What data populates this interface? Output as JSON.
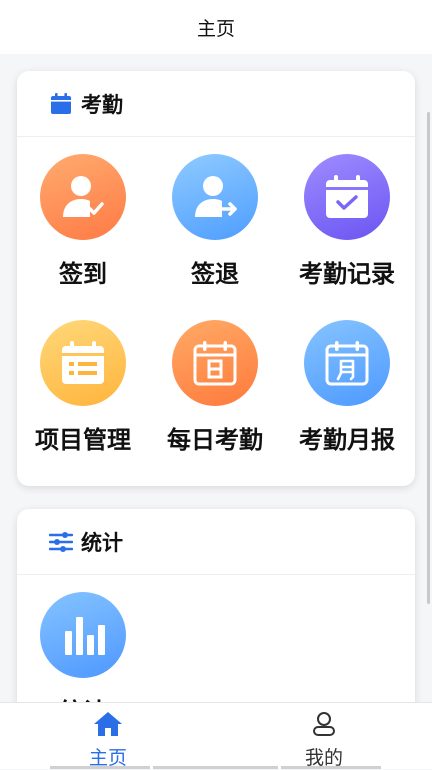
{
  "header": {
    "title": "主页"
  },
  "attendance": {
    "title": "考勤",
    "items": [
      {
        "label": "签到",
        "icon": "user-check-icon"
      },
      {
        "label": "签退",
        "icon": "user-logout-icon"
      },
      {
        "label": "考勤记录",
        "icon": "calendar-check-icon"
      },
      {
        "label": "项目管理",
        "icon": "project-calendar-icon"
      },
      {
        "label": "每日考勤",
        "icon": "calendar-day-icon"
      },
      {
        "label": "考勤月报",
        "icon": "calendar-month-icon"
      }
    ]
  },
  "statistics": {
    "title": "统计",
    "items": [
      {
        "label": "统计",
        "icon": "bar-chart-icon"
      }
    ]
  },
  "tabbar": {
    "items": [
      {
        "label": "主页",
        "icon": "home-icon",
        "active": true
      },
      {
        "label": "我的",
        "icon": "user-icon",
        "active": false
      }
    ]
  },
  "colors": {
    "accent": "#2b6fe8",
    "background": "#f5f6f8"
  }
}
